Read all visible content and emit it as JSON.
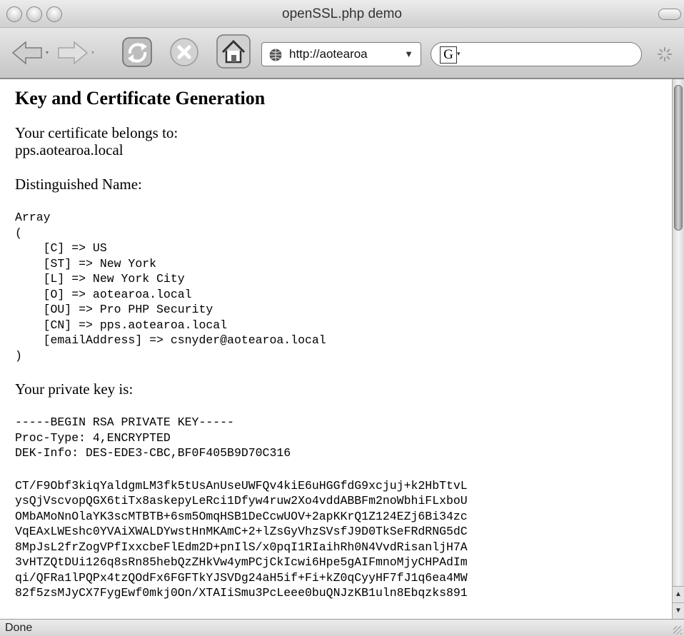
{
  "window": {
    "title": "openSSL.php demo"
  },
  "toolbar": {
    "url": "http://aotearoa",
    "search_logo": "G",
    "icons": [
      "back-icon",
      "forward-icon",
      "reload-icon",
      "stop-icon",
      "home-icon",
      "globe-icon",
      "activity-spinner-icon"
    ]
  },
  "page": {
    "heading": "Key and Certificate Generation",
    "cert_label": "Your certificate belongs to:",
    "cert_owner": "pps.aotearoa.local",
    "dn_label": "Distinguished Name:",
    "dn_array": "Array\n(\n    [C] => US\n    [ST] => New York\n    [L] => New York City\n    [O] => aotearoa.local\n    [OU] => Pro PHP Security\n    [CN] => pps.aotearoa.local\n    [emailAddress] => csnyder@aotearoa.local\n)",
    "key_label": "Your private key is:",
    "key_header": "-----BEGIN RSA PRIVATE KEY-----\nProc-Type: 4,ENCRYPTED\nDEK-Info: DES-EDE3-CBC,BF0F405B9D70C316",
    "key_body": "CT/F9Obf3kiqYaldgmLM3fk5tUsAnUseUWFQv4kiE6uHGGfdG9xcjuj+k2HbTtvL\nysQjVscvopQGX6tiTx8askepyLeRci1Dfyw4ruw2Xo4vddABBFm2noWbhiFLxboU\nOMbAMoNnOlaYK3scMTBTB+6sm5OmqHSB1DeCcwUOV+2apKKrQ1Z124EZj6Bi34zc\nVqEAxLWEshc0YVAiXWALDYwstHnMKAmC+2+lZsGyVhzSVsfJ9D0TkSeFRdRNG5dC\n8MpJsL2frZogVPfIxxcbeFlEdm2D+pnIlS/x0pqI1RIaihRh0N4VvdRisanljH7A\n3vHTZQtDUi126q8sRn85hebQzZHkVw4ymPCjCkIcwi6Hpe5gAIFmnoMjyCHPAdIm\nqi/QFRa1lPQPx4tzQOdFx6FGFTkYJSVDg24aH5if+Fi+kZ0qCyyHF7fJ1q6ea4MW\n82f5zsMJyCX7FygEwf0mkj0On/XTAIiSmu3PcLeee0buQNJzKB1uln8Ebqzks891"
  },
  "status": {
    "text": "Done"
  }
}
